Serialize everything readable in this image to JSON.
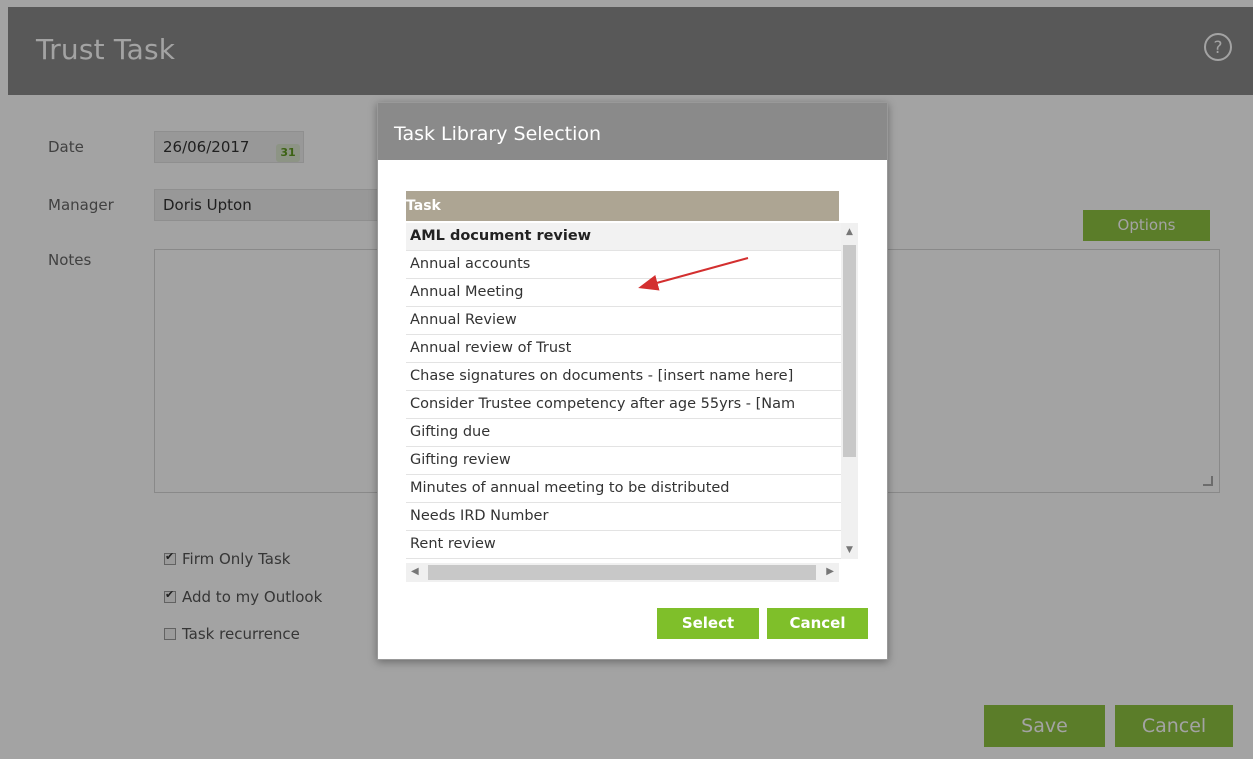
{
  "app": {
    "title": "Trust Task"
  },
  "form": {
    "date_label": "Date",
    "date_value": "26/06/2017",
    "calendar_icon_text": "31",
    "manager_label": "Manager",
    "manager_value": "Doris Upton",
    "notes_label": "Notes",
    "options_label": "Options",
    "checkboxes": [
      {
        "label": "Firm Only Task",
        "checked": true
      },
      {
        "label": "Add to my Outlook",
        "checked": true
      },
      {
        "label": "Task recurrence",
        "checked": false
      }
    ],
    "save_label": "Save",
    "cancel_label": "Cancel"
  },
  "dialog": {
    "title": "Task Library Selection",
    "column_header": "Task",
    "items": [
      "AML document review",
      "Annual accounts",
      "Annual Meeting",
      "Annual Review",
      "Annual review of Trust",
      "Chase signatures on documents - [insert name here]",
      "Consider Trustee competency after age 55yrs - [Nam",
      "Gifting due",
      "Gifting review",
      "Minutes of annual meeting to be distributed",
      "Needs IRD Number",
      "Rent review"
    ],
    "selected_index": 0,
    "select_label": "Select",
    "cancel_label": "Cancel"
  },
  "colors": {
    "accent_green": "#8fc440",
    "header_gray": "#8a8a8a",
    "table_header": "#ada593",
    "annotation_arrow": "#d32f2f"
  },
  "icons": {
    "help": "help-icon",
    "calendar": "calendar-icon"
  }
}
